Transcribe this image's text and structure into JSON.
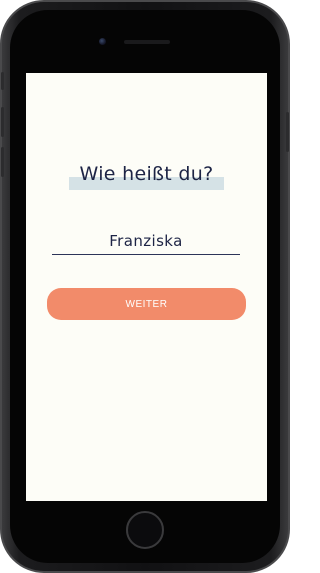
{
  "screen": {
    "title": "Wie heißt du?",
    "name_value": "Franziska",
    "button_label": "WEITER"
  },
  "colors": {
    "background": "#fdfdf7",
    "title_highlight": "#d5e2e6",
    "text": "#1d2445",
    "accent": "#f28b6a"
  }
}
